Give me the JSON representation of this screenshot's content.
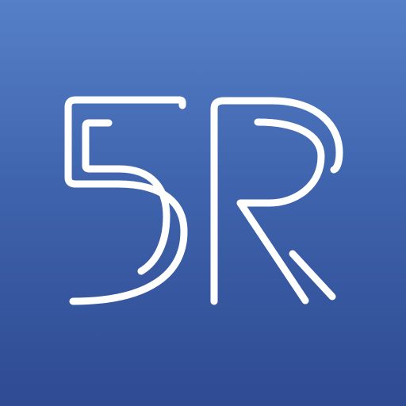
{
  "app_icon": {
    "logo_text": "5R",
    "colors": {
      "background_top": "#5580c8",
      "background_bottom": "#2e4a92",
      "stroke": "#ffffff"
    }
  }
}
